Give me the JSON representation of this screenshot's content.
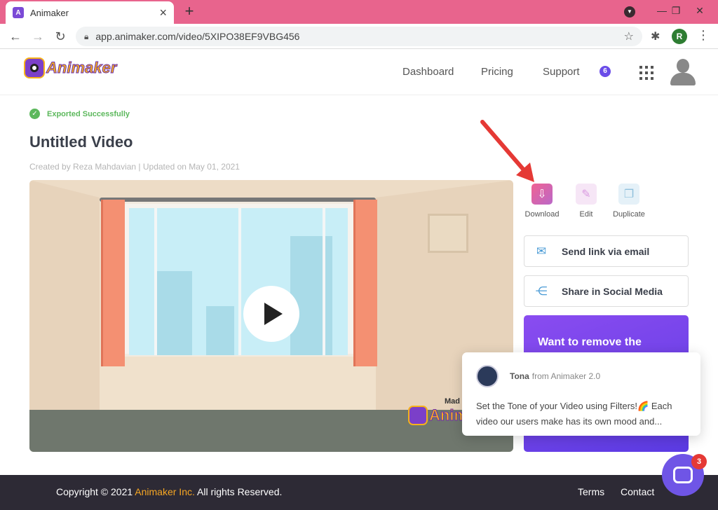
{
  "browser": {
    "tab_title": "Animaker",
    "tab_favicon": "A",
    "url": "app.animaker.com/video/5XIPO38EF9VBG456",
    "profile_initial": "R"
  },
  "header": {
    "logo_text": "Animaker",
    "nav": [
      "Dashboard",
      "Pricing",
      "Support"
    ],
    "notification_count": "6"
  },
  "main": {
    "export_status": "Exported Successfully",
    "title": "Untitled Video",
    "meta": "Created by Reza Mahdavian | Updated on May 01, 2021",
    "watermark_made": "Mad",
    "watermark_text": "Anim"
  },
  "actions": {
    "download": "Download",
    "edit": "Edit",
    "duplicate": "Duplicate",
    "send_email": "Send link via email",
    "share_social": "Share in Social Media"
  },
  "promo": {
    "text": "Want to remove the"
  },
  "chat": {
    "name": "Tona",
    "from": "from Animaker 2.0",
    "message": "Set the Tone of your Video using Filters!🌈 Each video our users make has its own mood and...",
    "unread_count": "3"
  },
  "footer": {
    "copyright_prefix": "Copyright © 2021",
    "company": "Animaker Inc.",
    "copyright_suffix": "All rights Reserved.",
    "terms": "Terms",
    "contact": "Contact"
  },
  "colors": {
    "tabbar": "#e8648d",
    "accent": "#6a4ce8",
    "success": "#5cb85c",
    "footer": "#2d2a35"
  }
}
